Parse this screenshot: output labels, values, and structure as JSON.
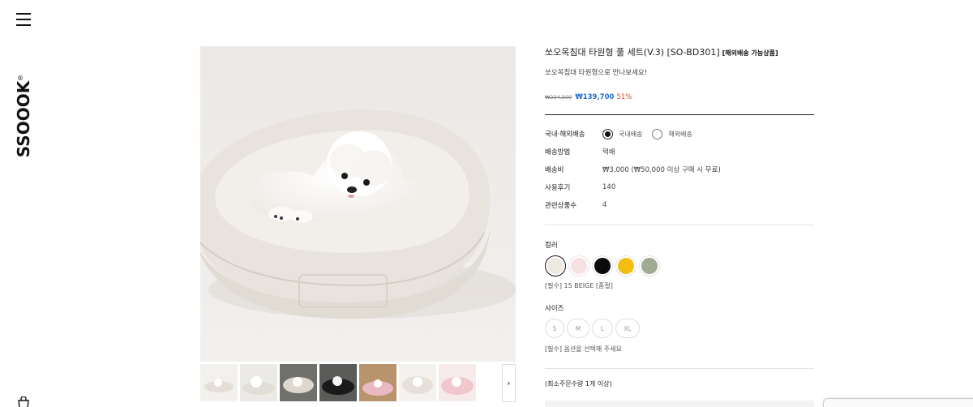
{
  "brand": {
    "logo_text": "SSOOOK",
    "reg_mark": "®"
  },
  "icons": {
    "menu": "hamburger-menu-icon",
    "cart": "shopping-bag-icon",
    "next": "chevron-right-icon"
  },
  "product": {
    "title": "쏘오옥침대 타원형 풀 세트(V.3) [SO-BD301]",
    "badge": "[해외배송 가능상품]",
    "subtitle": "쏘오옥침대 타원형으로 만나보세요!",
    "price_original": "₩234,500",
    "price_sale": "₩139,700",
    "discount_rate": "51%"
  },
  "specs": {
    "shipping_region": {
      "label": "국내·해외배송",
      "options": [
        "국내배송",
        "해외배송"
      ],
      "selected": "국내배송"
    },
    "shipping_method": {
      "label": "배송방법",
      "value": "택배"
    },
    "shipping_fee": {
      "label": "배송비",
      "value": "₩3,000 (₩50,000 이상 구매 시 무료)"
    },
    "reviews": {
      "label": "사용후기",
      "value": "140"
    },
    "related": {
      "label": "관련상품수",
      "value": "4"
    }
  },
  "color_option": {
    "title": "컬러",
    "swatches": [
      {
        "name": "BEIGE",
        "color": "#ece9e2",
        "selected": true
      },
      {
        "name": "PINK",
        "color": "#f7e1e3",
        "selected": false
      },
      {
        "name": "BLACK",
        "color": "#0b0b0b",
        "selected": false
      },
      {
        "name": "YELLOW",
        "color": "#f4bd12",
        "selected": false
      },
      {
        "name": "GREEN",
        "color": "#9fab93",
        "selected": false
      }
    ],
    "note": "[필수] 15 BEIGE [품절]"
  },
  "size_option": {
    "title": "사이즈",
    "sizes": [
      "S",
      "M",
      "L",
      "XL"
    ],
    "note": "[필수] 옵션을 선택해 주세요"
  },
  "min_order": "(최소주문수량 1개 이상)",
  "accent_colors": {
    "price": "#1e6fd0",
    "discount": "#e1462f"
  }
}
